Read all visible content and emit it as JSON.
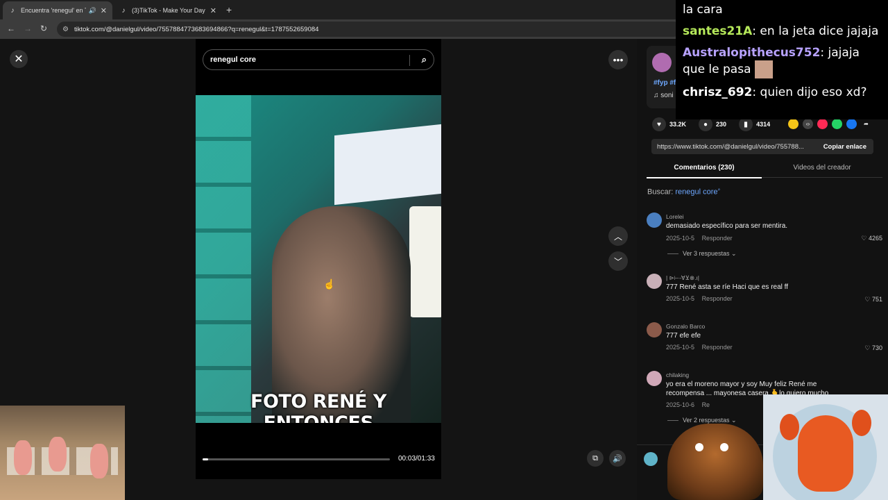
{
  "browser": {
    "tabs": [
      {
        "title": "Encuentra 'renegul' en TikTo",
        "active": true
      },
      {
        "title": "(3)TikTok - Make Your Day",
        "active": false
      }
    ],
    "new_tab": "+",
    "url": "tiktok.com/@danielgul/video/7557884773683694866?q=renegul&t=1787552659084"
  },
  "viewer": {
    "search": {
      "value": "renegul core"
    },
    "video_caption": "FOTO RENÉ Y ENTONCES",
    "playback": {
      "current": "00:03",
      "total": "01:33",
      "timecode": "00:03/01:33",
      "progress_fraction": 0.03
    },
    "icons": {
      "close": "close-icon",
      "more": "more-icon",
      "up": "chevron-up-icon",
      "down": "chevron-down-icon",
      "pip": "pip-icon",
      "volume": "volume-icon"
    }
  },
  "panel": {
    "creator": {
      "tags": "#fyp #f",
      "sound": "♫ soni"
    },
    "stats": {
      "likes": "33.2K",
      "comments": "230",
      "saves": "4314"
    },
    "share_colors": [
      "#f5c518",
      "#444444",
      "#ff2a55",
      "#25d366",
      "#1877f2"
    ],
    "link": {
      "url": "https://www.tiktok.com/@danielgul/video/755788...",
      "copy_label": "Copiar enlace"
    },
    "tabs": {
      "comments": "Comentarios (230)",
      "creator_videos": "Videos del creador"
    },
    "search": {
      "prefix": "Buscar:",
      "query": "renegul core"
    },
    "comments": [
      {
        "user": "Lorelei",
        "text": "demasiado específico para ser mentira.",
        "date": "2025-10-5",
        "reply": "Responder",
        "likes": "4265",
        "replies": "Ver 3 respuestas",
        "avatar_color": "#4a7fc0"
      },
      {
        "user": "| ⊳⊢-∀⊻⊗.ı|",
        "text": "777 René asta se ríe Haci que es real ff",
        "date": "2025-10-5",
        "reply": "Responder",
        "likes": "751",
        "replies": "",
        "avatar_color": "#c9b0b8"
      },
      {
        "user": "Gonzalo Barco",
        "text": "777 efe efe",
        "date": "2025-10-5",
        "reply": "Responder",
        "likes": "730",
        "replies": "",
        "avatar_color": "#8b5a4a"
      },
      {
        "user": "chilaking",
        "text": "yo era el moreno mayor y soy Muy feliz René me recompensa ... mayonesa casera 🫰lo quiero mucho",
        "date": "2025-10-6",
        "reply": "Re",
        "likes": "",
        "replies": "Ver 2 respuestas",
        "avatar_color": "#d0a8b8"
      }
    ]
  },
  "chat_overlay": {
    "lines": [
      {
        "user": "",
        "msg": "la cara"
      },
      {
        "user": "santes21A",
        "msg": ": en la jeta dice jajaja"
      },
      {
        "user": "Australopithecus752",
        "msg": ": jajaja que le pasa"
      },
      {
        "user": "chrisz_692",
        "msg": ": quien dijo eso xd?"
      }
    ]
  }
}
